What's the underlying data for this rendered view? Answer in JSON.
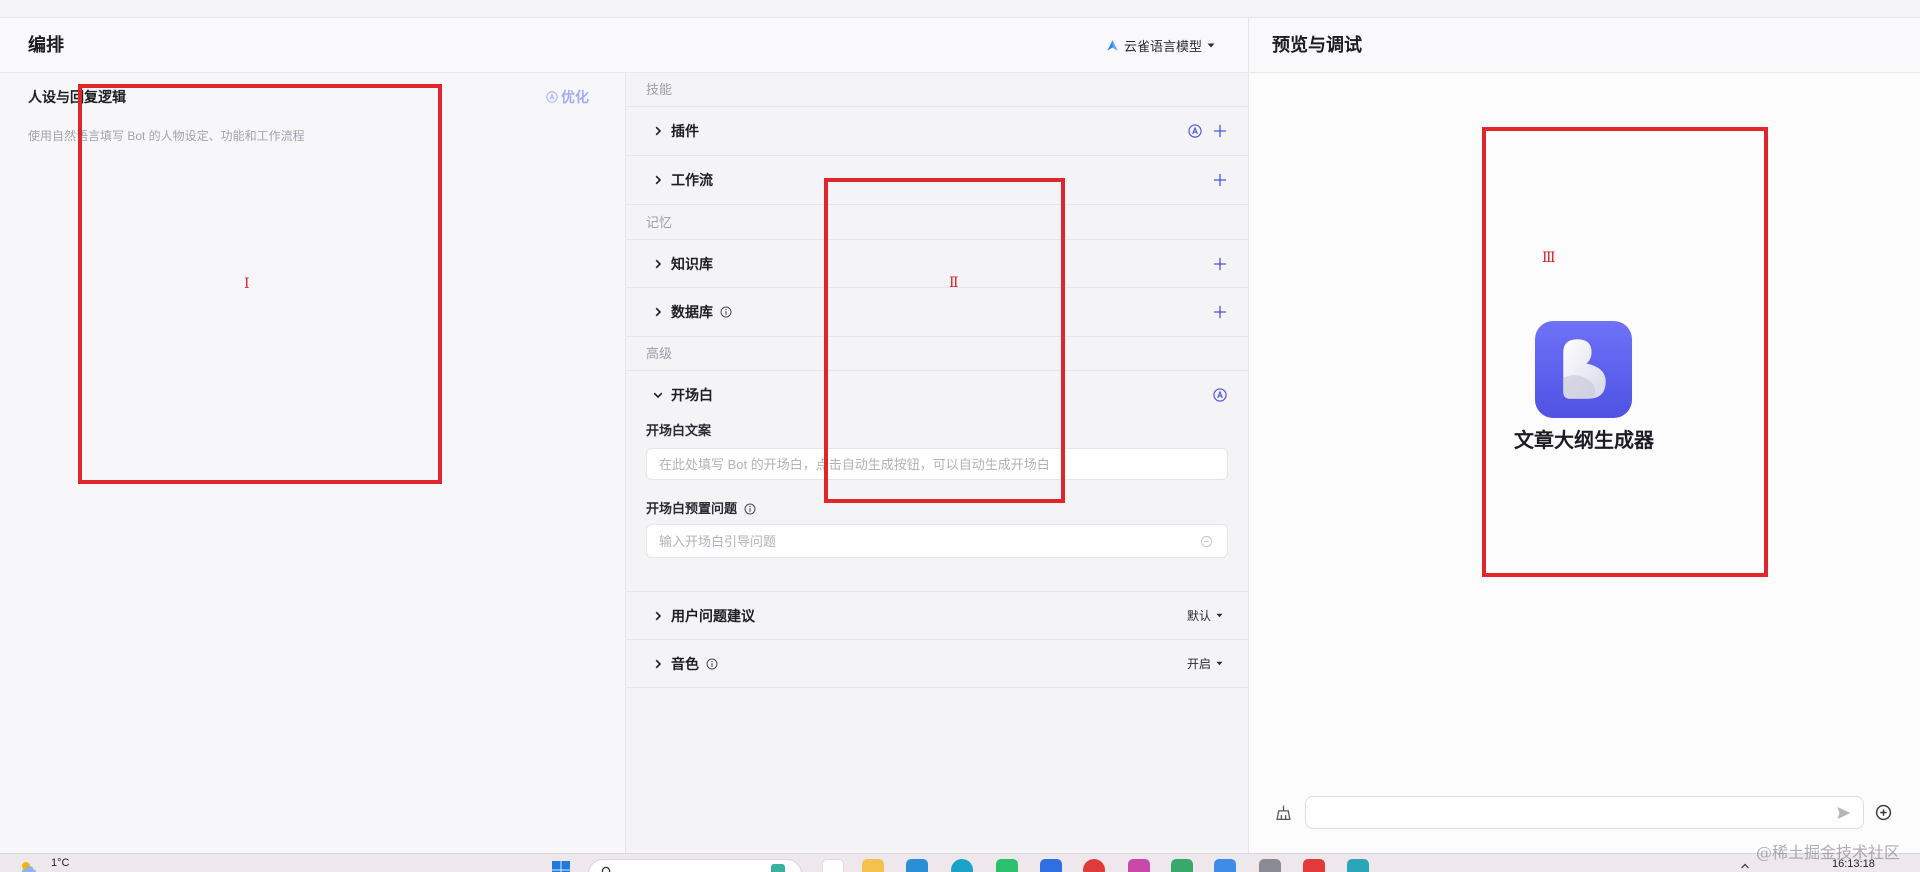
{
  "editor": {
    "title": "编排",
    "model_selector": {
      "label": "云雀语言模型"
    }
  },
  "persona": {
    "title": "人设与回复逻辑",
    "optimize_label": "优化",
    "placeholder": "使用自然语言填写 Bot 的人物设定、功能和工作流程"
  },
  "skills": {
    "section_label": "技能",
    "items": [
      {
        "label": "插件"
      },
      {
        "label": "工作流"
      }
    ]
  },
  "memory": {
    "section_label": "记忆",
    "items": [
      {
        "label": "知识库"
      },
      {
        "label": "数据库"
      }
    ]
  },
  "advanced": {
    "section_label": "高级",
    "opening": {
      "title": "开场白",
      "text_label": "开场白文案",
      "text_placeholder": "在此处填写 Bot 的开场白，点击自动生成按钮，可以自动生成开场白",
      "questions_label": "开场白预置问题",
      "questions_placeholder": "输入开场白引导问题"
    },
    "suggestions": {
      "label": "用户问题建议",
      "value": "默认"
    },
    "voice": {
      "label": "音色",
      "value": "开启"
    }
  },
  "preview": {
    "title": "预览与调试",
    "bot_name": "文章大纲生成器"
  },
  "annotations": [
    {
      "label": "Ⅰ"
    },
    {
      "label": "Ⅱ"
    },
    {
      "label": "Ⅲ"
    }
  ],
  "taskbar": {
    "weather": "1°C",
    "clock": "16:13:18"
  },
  "watermark": "@稀土掘金技术社区",
  "colors": {
    "accent": "#4d53e8",
    "optimize": "#a7aaf4",
    "annotation": "#e0262d",
    "avatar_top": "#6e72f8",
    "avatar_bottom": "#4f52e3",
    "model_icon": "#2f80f5"
  },
  "icons": {
    "model": "model-icon",
    "optimize": "auto-optimize-icon",
    "expand": "chevron-right-icon",
    "collapse": "chevron-down-icon",
    "add": "plus-icon",
    "auto": "auto-icon",
    "info": "info-icon",
    "clear_chat": "broom-icon",
    "send": "send-icon",
    "attach": "plus-circle-icon"
  }
}
